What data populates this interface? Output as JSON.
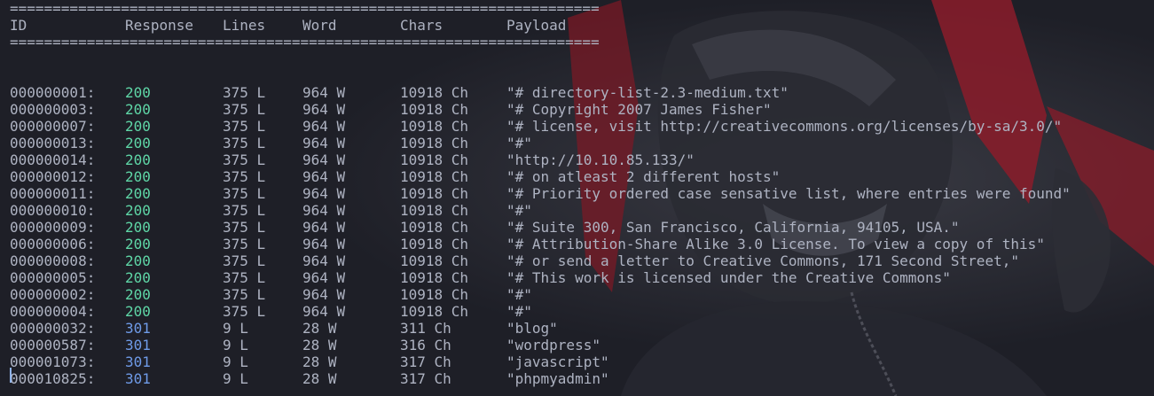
{
  "separator": "=====================================================================",
  "header": {
    "id": "ID",
    "response": "Response",
    "lines": "Lines",
    "word": "Word",
    "chars": "Chars",
    "payload": "Payload"
  },
  "colors": {
    "status_200": "#5fd7a7",
    "status_301": "#6f9be8",
    "text": "#aeb3c2",
    "background": "#1e1f27",
    "wallpaper_accent": "#8b1c2a"
  },
  "rows": [
    {
      "id": "000000001:",
      "response": "200",
      "lines": "375 L",
      "word": "964 W",
      "chars": "10918 Ch",
      "payload": "\"# directory-list-2.3-medium.txt\""
    },
    {
      "id": "000000003:",
      "response": "200",
      "lines": "375 L",
      "word": "964 W",
      "chars": "10918 Ch",
      "payload": "\"# Copyright 2007 James Fisher\""
    },
    {
      "id": "000000007:",
      "response": "200",
      "lines": "375 L",
      "word": "964 W",
      "chars": "10918 Ch",
      "payload": "\"# license, visit http://creativecommons.org/licenses/by-sa/3.0/\""
    },
    {
      "id": "000000013:",
      "response": "200",
      "lines": "375 L",
      "word": "964 W",
      "chars": "10918 Ch",
      "payload": "\"#\""
    },
    {
      "id": "000000014:",
      "response": "200",
      "lines": "375 L",
      "word": "964 W",
      "chars": "10918 Ch",
      "payload": "\"http://10.10.85.133/\""
    },
    {
      "id": "000000012:",
      "response": "200",
      "lines": "375 L",
      "word": "964 W",
      "chars": "10918 Ch",
      "payload": "\"# on atleast 2 different hosts\""
    },
    {
      "id": "000000011:",
      "response": "200",
      "lines": "375 L",
      "word": "964 W",
      "chars": "10918 Ch",
      "payload": "\"# Priority ordered case sensative list, where entries were found\""
    },
    {
      "id": "000000010:",
      "response": "200",
      "lines": "375 L",
      "word": "964 W",
      "chars": "10918 Ch",
      "payload": "\"#\""
    },
    {
      "id": "000000009:",
      "response": "200",
      "lines": "375 L",
      "word": "964 W",
      "chars": "10918 Ch",
      "payload": "\"# Suite 300, San Francisco, California, 94105, USA.\""
    },
    {
      "id": "000000006:",
      "response": "200",
      "lines": "375 L",
      "word": "964 W",
      "chars": "10918 Ch",
      "payload": "\"# Attribution-Share Alike 3.0 License. To view a copy of this\""
    },
    {
      "id": "000000008:",
      "response": "200",
      "lines": "375 L",
      "word": "964 W",
      "chars": "10918 Ch",
      "payload": "\"# or send a letter to Creative Commons, 171 Second Street,\""
    },
    {
      "id": "000000005:",
      "response": "200",
      "lines": "375 L",
      "word": "964 W",
      "chars": "10918 Ch",
      "payload": "\"# This work is licensed under the Creative Commons\""
    },
    {
      "id": "000000002:",
      "response": "200",
      "lines": "375 L",
      "word": "964 W",
      "chars": "10918 Ch",
      "payload": "\"#\""
    },
    {
      "id": "000000004:",
      "response": "200",
      "lines": "375 L",
      "word": "964 W",
      "chars": "10918 Ch",
      "payload": "\"#\""
    },
    {
      "id": "000000032:",
      "response": "301",
      "lines": "9 L",
      "word": "28 W",
      "chars": "311 Ch",
      "payload": "\"blog\""
    },
    {
      "id": "000000587:",
      "response": "301",
      "lines": "9 L",
      "word": "28 W",
      "chars": "316 Ch",
      "payload": "\"wordpress\""
    },
    {
      "id": "000001073:",
      "response": "301",
      "lines": "9 L",
      "word": "28 W",
      "chars": "317 Ch",
      "payload": "\"javascript\""
    },
    {
      "id": "000010825:",
      "response": "301",
      "lines": "9 L",
      "word": "28 W",
      "chars": "317 Ch",
      "payload": "\"phpmyadmin\""
    }
  ]
}
